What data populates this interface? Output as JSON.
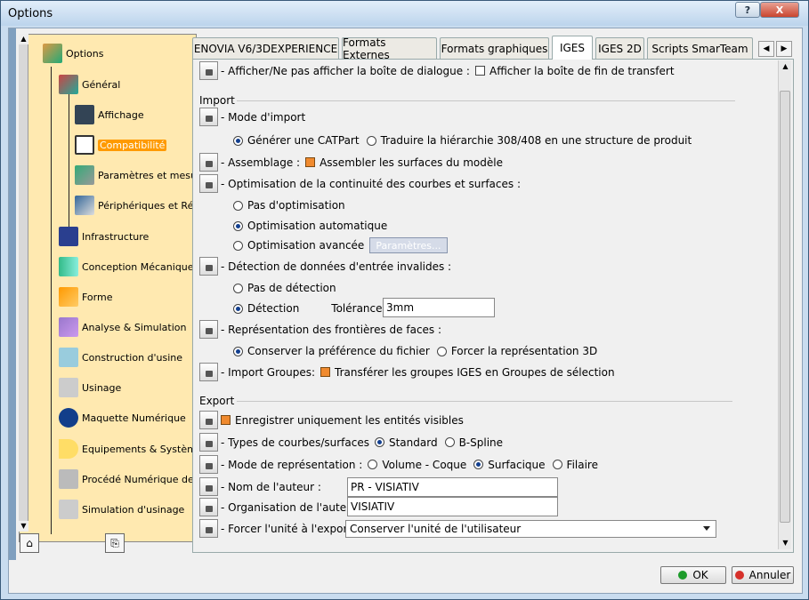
{
  "window": {
    "title": "Options",
    "help_label": "?",
    "close_label": "X"
  },
  "tree": {
    "items": [
      {
        "label": "Options"
      },
      {
        "label": "Général"
      },
      {
        "label": "Affichage"
      },
      {
        "label": "Compatibilité"
      },
      {
        "label": "Paramètres et mesure"
      },
      {
        "label": "Périphériques et Réali"
      },
      {
        "label": "Infrastructure"
      },
      {
        "label": "Conception Mécanique"
      },
      {
        "label": "Forme"
      },
      {
        "label": "Analyse & Simulation"
      },
      {
        "label": "Construction d'usine"
      },
      {
        "label": "Usinage"
      },
      {
        "label": "Maquette Numérique"
      },
      {
        "label": "Equipements & Systèmes"
      },
      {
        "label": "Procédé Numérique de F:"
      },
      {
        "label": "Simulation d'usinage"
      }
    ],
    "scroll_up": "▲",
    "scroll_down": "▼"
  },
  "tabs": [
    {
      "label": "ENOVIA V6/3DEXPERIENCE"
    },
    {
      "label": "Formats Externes"
    },
    {
      "label": "Formats graphiques"
    },
    {
      "label": "IGES"
    },
    {
      "label": "IGES 2D"
    },
    {
      "label": "Scripts SmarTeam"
    }
  ],
  "tab_scroll": {
    "left": "◀",
    "right": "▶"
  },
  "panel": {
    "show_dialog_label": "- Afficher/Ne pas afficher la boîte de dialogue :",
    "show_dialog_check": "Afficher la boîte de fin de transfert",
    "import_section": "Import",
    "import_mode": "- Mode d'import",
    "import_mode_opt1": "Générer une CATPart",
    "import_mode_opt2": "Traduire la hiérarchie 308/408 en une structure de produit",
    "assembly_label": "- Assemblage :",
    "assembly_check": "Assembler les surfaces du modèle",
    "optim_label": "- Optimisation de la continuité des courbes et surfaces :",
    "optim_opt1": "Pas d'optimisation",
    "optim_opt2": "Optimisation automatique",
    "optim_opt3": "Optimisation avancée",
    "optim_params_btn": "Paramètres...",
    "detect_label": "- Détection de données d'entrée invalides :",
    "detect_opt1": "Pas de détection",
    "detect_opt2": "Détection",
    "tolerance_label": "Tolérance :",
    "tolerance_value": "3mm",
    "faces_label": "- Représentation des frontières de faces :",
    "faces_opt1": "Conserver la préférence du fichier",
    "faces_opt2": "Forcer la représentation 3D",
    "groups_label": "- Import Groupes:",
    "groups_check": "Transférer les groupes IGES en Groupes de sélection",
    "export_section": "Export",
    "visible_only": "Enregistrer uniquement les entités visibles",
    "curves_label": "- Types de courbes/surfaces",
    "curves_opt1": "Standard",
    "curves_opt2": "B-Spline",
    "repr_label": "- Mode de représentation :",
    "repr_opt1": "Volume - Coque",
    "repr_opt2": "Surfacique",
    "repr_opt3": "Filaire",
    "author_label": "- Nom de l'auteur :",
    "author_value": "PR - VISIATIV",
    "org_label": "- Organisation de l'auteur :",
    "org_value": "VISIATIV",
    "unit_label": "- Forcer l'unité à l'export :",
    "unit_value": "Conserver l'unité de l'utilisateur"
  },
  "footer": {
    "ok_label": "OK",
    "cancel_label": "Annuler"
  },
  "colors": {
    "tree_bg": "#ffe9b0",
    "selected": "#ff9a00",
    "accent": "#123f8f"
  }
}
